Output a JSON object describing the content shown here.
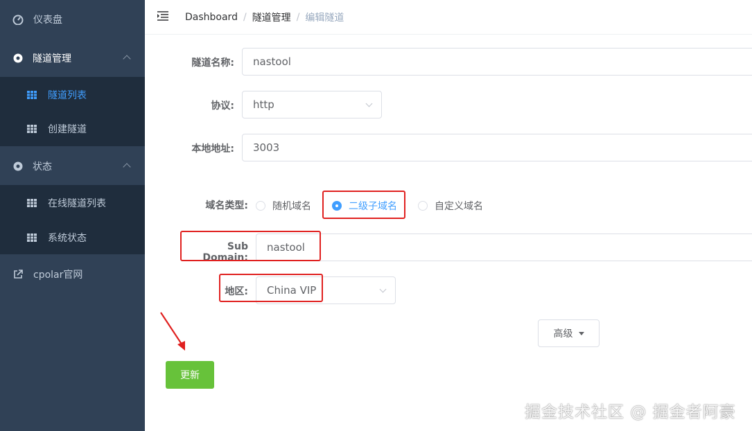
{
  "sidebar": {
    "items": [
      {
        "label": "仪表盘",
        "icon": "dashboard-icon"
      },
      {
        "label": "隧道管理",
        "icon": "lifebuoy-icon"
      },
      {
        "label": "隧道列表",
        "icon": "table-icon"
      },
      {
        "label": "创建隧道",
        "icon": "table-icon"
      },
      {
        "label": "状态",
        "icon": "lifebuoy-icon"
      },
      {
        "label": "在线隧道列表",
        "icon": "table-icon"
      },
      {
        "label": "系统状态",
        "icon": "table-icon"
      },
      {
        "label": "cpolar官网",
        "icon": "external-link-icon"
      }
    ],
    "active_item": "隧道列表"
  },
  "header": {
    "breadcrumb": [
      "Dashboard",
      "隧道管理",
      "编辑隧道"
    ]
  },
  "form": {
    "name_label": "隧道名称:",
    "name_value": "nastool",
    "protocol_label": "协议:",
    "protocol_value": "http",
    "local_label": "本地地址:",
    "local_value": "3003",
    "domain_type_label": "域名类型:",
    "domain_types": [
      "随机域名",
      "二级子域名",
      "自定义域名"
    ],
    "domain_type_selected": "二级子域名",
    "subdomain_label": "Sub Domain:",
    "subdomain_value": "nastool",
    "region_label": "地区:",
    "region_value": "China VIP",
    "advanced_label": "高级",
    "update_label": "更新"
  },
  "watermark": "掘金技术社区 @ 掘金者阿豪",
  "colors": {
    "sidebar_bg": "#304156",
    "submenu_bg": "#1f2d3d",
    "accent": "#409eff",
    "update_button": "#67c23a",
    "highlight": "#e0201f"
  }
}
